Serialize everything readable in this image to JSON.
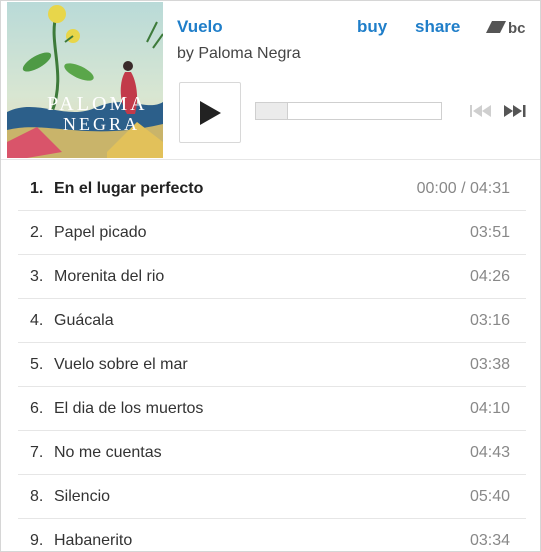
{
  "header": {
    "album_title": "Vuelo",
    "artist_line": "by Paloma Negra",
    "buy_label": "buy",
    "share_label": "share",
    "logo_text": "bc",
    "cover_text_line1": "PALOMA",
    "cover_text_line2": "NEGRA"
  },
  "player": {
    "progress_fraction": 0.0
  },
  "tracks": [
    {
      "num": "1.",
      "title": "En el lugar perfecto",
      "time": "00:00 / 04:31",
      "active": true
    },
    {
      "num": "2.",
      "title": "Papel picado",
      "time": "03:51"
    },
    {
      "num": "3.",
      "title": "Morenita del rio",
      "time": "04:26"
    },
    {
      "num": "4.",
      "title": "Guácala",
      "time": "03:16"
    },
    {
      "num": "5.",
      "title": "Vuelo sobre el mar",
      "time": "03:38"
    },
    {
      "num": "6.",
      "title": "El dia de los muertos",
      "time": "04:10"
    },
    {
      "num": "7.",
      "title": "No me cuentas",
      "time": "04:43"
    },
    {
      "num": "8.",
      "title": "Silencio",
      "time": "05:40"
    },
    {
      "num": "9.",
      "title": "Habanerito",
      "time": "03:34"
    }
  ],
  "colors": {
    "link": "#1f7ec9",
    "muted": "#888888"
  }
}
